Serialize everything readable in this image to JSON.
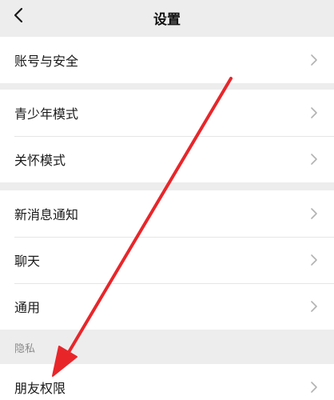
{
  "header": {
    "title": "设置",
    "back_icon": "chevron-left-icon"
  },
  "groups": [
    {
      "items": [
        {
          "label": "账号与安全"
        }
      ]
    },
    {
      "items": [
        {
          "label": "青少年模式"
        },
        {
          "label": "关怀模式"
        }
      ]
    },
    {
      "items": [
        {
          "label": "新消息通知"
        },
        {
          "label": "聊天"
        },
        {
          "label": "通用"
        }
      ]
    }
  ],
  "privacy": {
    "section_label": "隐私",
    "items": [
      {
        "label": "朋友权限"
      }
    ]
  },
  "colors": {
    "background": "#ededed",
    "row_background": "#ffffff",
    "annotation_arrow": "#e8262a"
  }
}
